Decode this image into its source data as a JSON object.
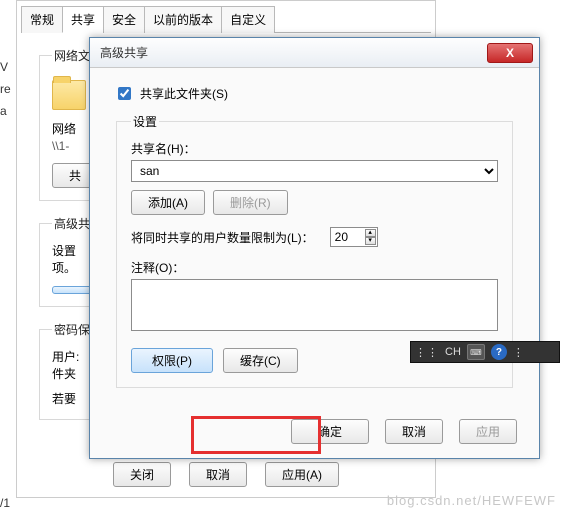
{
  "tabs": {
    "general": "常规",
    "share": "共享",
    "security": "安全",
    "prev": "以前的版本",
    "custom": "自定义"
  },
  "bg": {
    "section1_title": "网络文",
    "net_label": "网络",
    "path_label": "\\\\1-",
    "share_btn": "共",
    "adv_label": "高级共",
    "setup_txt": "设置",
    "opt_txt": "项。",
    "pass_label": "密码保",
    "user_txt": "用户:",
    "folder_txt": "件夹",
    "if_txt": "若要",
    "close_btn": "关闭",
    "cancel_btn": "取消",
    "apply_btn": "应用(A)"
  },
  "adv": {
    "title": "高级共享",
    "close_x": "X",
    "share_chk": "共享此文件夹(S)",
    "settings_legend": "设置",
    "share_name_label": "共享名(H)：",
    "share_name_value": "san",
    "add_btn": "添加(A)",
    "remove_btn": "删除(R)",
    "limit_label": "将同时共享的用户数量限制为(L)：",
    "limit_value": "20",
    "comment_label": "注释(O)：",
    "comment_value": "",
    "perm_btn": "权限(P)",
    "cache_btn": "缓存(C)",
    "ok_btn": "确定",
    "cancel_btn": "取消",
    "apply_btn": "应用"
  },
  "ime": {
    "mode": "CH",
    "help": "?"
  },
  "edge": {
    "v": "V",
    "r": "re",
    "a": "a",
    "l": "/1"
  },
  "watermark": "blog.csdn.net/HEWFEWF"
}
